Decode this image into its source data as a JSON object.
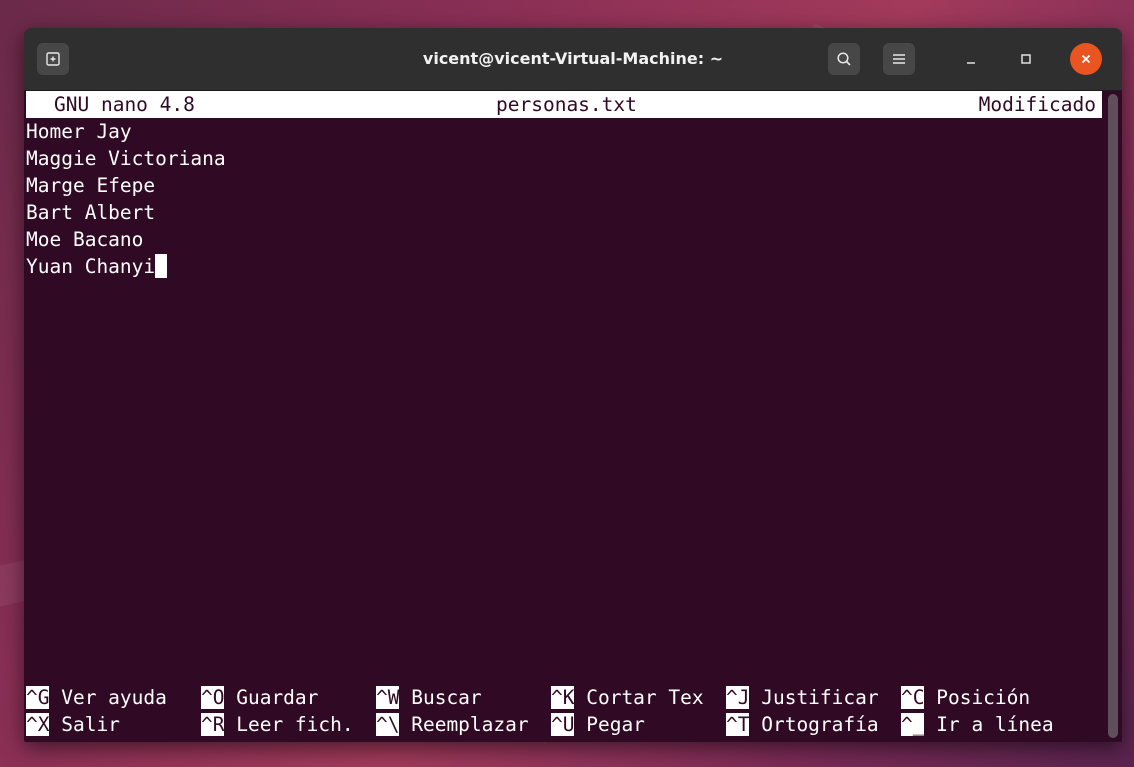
{
  "window": {
    "title": "vicent@vicent-Virtual-Machine: ~"
  },
  "icons": {
    "new_tab": "new-tab-icon",
    "search": "search-icon",
    "menu": "hamburger-menu-icon",
    "minimize": "minimize-icon",
    "maximize": "maximize-icon",
    "close": "close-icon"
  },
  "colors": {
    "terminal_bg": "#300a24",
    "accent_close": "#e95420"
  },
  "nano": {
    "version": "GNU nano 4.8",
    "filename": "personas.txt",
    "status": "Modificado"
  },
  "content": {
    "lines": [
      "Homer Jay",
      "Maggie Victoriana",
      "Marge Efepe",
      "Bart Albert",
      "Moe Bacano",
      "Yuan Chanyi"
    ]
  },
  "shortcuts": {
    "row1": [
      {
        "key": "^G",
        "label": " Ver ayuda"
      },
      {
        "key": "^O",
        "label": " Guardar"
      },
      {
        "key": "^W",
        "label": " Buscar"
      },
      {
        "key": "^K",
        "label": " Cortar Tex"
      },
      {
        "key": "^J",
        "label": " Justificar"
      },
      {
        "key": "^C",
        "label": " Posición"
      }
    ],
    "row2": [
      {
        "key": "^X",
        "label": " Salir"
      },
      {
        "key": "^R",
        "label": " Leer fich."
      },
      {
        "key": "^\\",
        "label": " Reemplazar"
      },
      {
        "key": "^U",
        "label": " Pegar"
      },
      {
        "key": "^T",
        "label": " Ortografía"
      },
      {
        "key": "^_",
        "label": " Ir a línea"
      }
    ]
  }
}
